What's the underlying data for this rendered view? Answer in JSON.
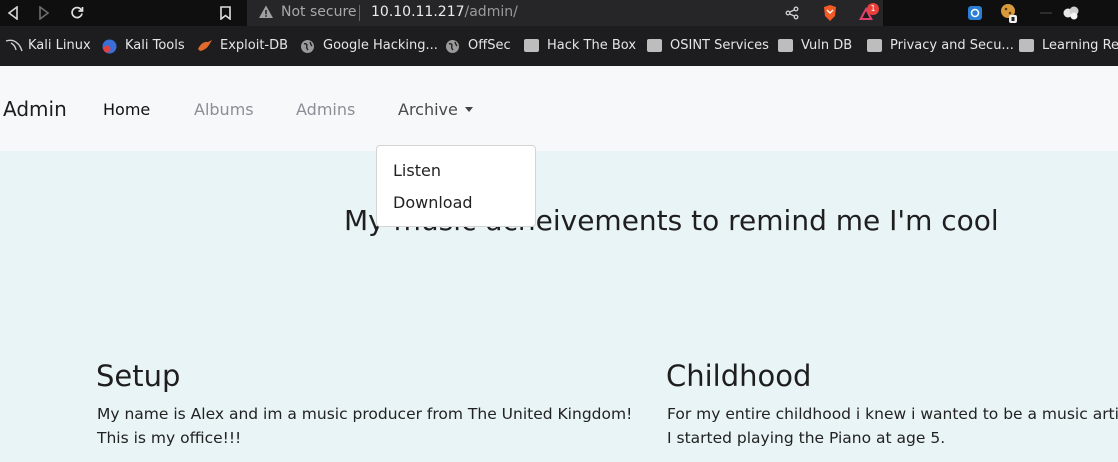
{
  "browser": {
    "security_label": "Not secure",
    "url_host": "10.10.11.217",
    "url_path": "/admin/",
    "badge_count": "1"
  },
  "bookmarks": [
    {
      "label": "Kali Linux",
      "icon": "kali-dragon-icon"
    },
    {
      "label": "Kali Tools",
      "icon": "kali-tools-icon"
    },
    {
      "label": "Exploit-DB",
      "icon": "exploit-db-icon"
    },
    {
      "label": "Google Hacking...",
      "icon": "globe-icon"
    },
    {
      "label": "OffSec",
      "icon": "globe-icon"
    },
    {
      "label": "Hack The Box",
      "icon": "folder-icon"
    },
    {
      "label": "OSINT Services",
      "icon": "folder-icon"
    },
    {
      "label": "Vuln DB",
      "icon": "folder-icon"
    },
    {
      "label": "Privacy and Secu...",
      "icon": "folder-icon"
    },
    {
      "label": "Learning Res",
      "icon": "folder-icon"
    }
  ],
  "nav": {
    "brand": "Admin",
    "items": [
      "Home",
      "Albums",
      "Admins",
      "Archive"
    ],
    "dropdown": [
      "Listen",
      "Download"
    ]
  },
  "hero": {
    "heading": "My music acheivements to remind me I'm cool"
  },
  "sections": [
    {
      "title": "Setup",
      "lines": [
        "My name is Alex and im a music producer from The United Kingdom!",
        "This is my office!!!"
      ]
    },
    {
      "title": "Childhood",
      "lines": [
        "For my entire childhood i knew i wanted to be a music artist.",
        "I started playing the Piano at age 5."
      ]
    }
  ],
  "colors": {
    "page_bg": "#e9f4f6",
    "navbar_bg": "#f7f8fa",
    "chrome_bg": "#0f0f10"
  }
}
